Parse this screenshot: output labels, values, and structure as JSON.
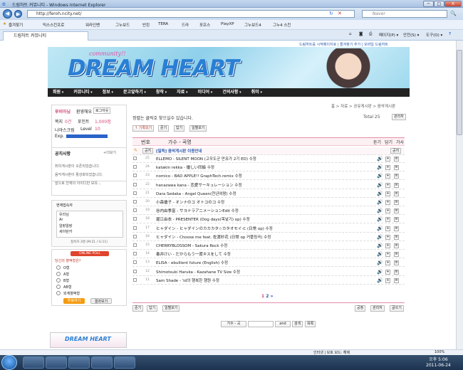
{
  "window": {
    "title": "드림하트 커뮤니티 - Windows Internet Explorer",
    "min": "─",
    "max": "□",
    "close": "X"
  },
  "address": {
    "url": "http://feroh.ncity.net/",
    "search_placeholder": "Naver"
  },
  "favbar": {
    "favorites": "즐겨찾기",
    "items": [
      "믹스스킨프로",
      "워라인벤",
      "그누보드",
      "빈킹",
      "TERA",
      "드라",
      "포프스",
      "PlayXP",
      "그누보드4",
      "그누4 스킨"
    ]
  },
  "tab": {
    "label": "드림하트 커뮤니티"
  },
  "cmdbar": {
    "page": "페이지(P) ▾",
    "safety": "안전(S) ▾",
    "tools": "도구(O) ▾",
    "help": "?"
  },
  "site": {
    "toplinks": "드림하트를 시작페이지로 | 즐겨찾기 추가 | 모바일 드림하트",
    "logo_small": "community!!",
    "logo": "DREAM HEART",
    "menu": [
      "회원",
      "커뮤니티",
      "정보",
      "문고앞하기",
      "창작",
      "자료",
      "미디어",
      "건의사항",
      "취미"
    ]
  },
  "user": {
    "greeting": "루비아님",
    "welcome": "환영해요",
    "logout": "로그아웃",
    "money_label": "쪽지",
    "money_value": "0건",
    "point_label": "포인트",
    "point_value": "1,000점",
    "nick": "나야스크림",
    "level_label": "Level",
    "level_value": "10",
    "exp_label": "Exp."
  },
  "notice": {
    "title": "공지사항",
    "more": "+더보기",
    "items": [
      "취미게시판이 오픈되었습니다.",
      "음악게시판이 활성화되었습니다.",
      "앞으로 잔재의 아이디만 보유..."
    ]
  },
  "chat": {
    "title": "현재접속자",
    "users": [
      "유리님",
      "Ar",
      "알랑알랑",
      "세이탄카"
    ],
    "count": "접속자 3명 (M:21 / G:11)"
  },
  "poll": {
    "header": "ONLINE POLL",
    "question": "당신의 혈액형은?",
    "options": [
      "O형",
      "A형",
      "B형",
      "AB형",
      "외계혈액형"
    ],
    "vote": "투표하기",
    "result": "결과보기"
  },
  "board": {
    "breadcrumb": "홈 > 자료 > 공유게시판 > 음악게시판",
    "desc": "정렬는 클릭호 찾으실수 있습니다.",
    "total_label": "Total 25",
    "admin": "관리자",
    "tools": [
      "↑ 기록보기",
      "준기",
      "답기",
      "일별보기"
    ],
    "col_num": "번호",
    "col_title": "가수 - 곡명",
    "col_listen": "듣기",
    "col_down": "담기",
    "col_lyric": "가사",
    "notice_tag": "공지",
    "notice_row": "[필독] 음악게시판 이용안내",
    "rows": [
      {
        "num": "25",
        "title": "ELLEMO - SILENT MOON (고우도군 만유가 2기 ED) 수정"
      },
      {
        "num": "24",
        "title": "katakin rekka - 優しい同級 수정"
      },
      {
        "num": "23",
        "title": "nomico - BAD APPLE!! GraphTech.remix 수정"
      },
      {
        "num": "22",
        "title": "hanazawa kana - 恋愛サーキュレーション 수정"
      },
      {
        "num": "21",
        "title": "Dara Sedaka - Angel Queen(천년여왕) 수정"
      },
      {
        "num": "20",
        "title": "小森優子 - オンナのコ オトコのコ 수정"
      },
      {
        "num": "19",
        "title": "谷内由季富 - サヨナラアニメーションEdit 수정"
      },
      {
        "num": "18",
        "title": "堀江由衣 - PRESENTER (Dog days(목넣기) op) 수정"
      },
      {
        "num": "17",
        "title": "ヒャダイン - ヒャダインのカカカタ☆カタオモイ-C (日常 op) 수정"
      },
      {
        "num": "16",
        "title": "ヒャダイン - Choose me feat. 佐渡紗花 (日常 op 커플링곡) 수정"
      },
      {
        "num": "15",
        "title": "CHERRYBLOSSOM - Sakura Rock 수정"
      },
      {
        "num": "14",
        "title": "奏井けい - だからもう一度キスをして 수정"
      },
      {
        "num": "13",
        "title": "ELISA - ebullient future (English) 수정"
      },
      {
        "num": "12",
        "title": "Shimotsuki Haruka - Kazahane TV Size 수정"
      },
      {
        "num": "11",
        "title": "Sam Shade - 'id의 행복한 행원 수정"
      }
    ],
    "pages": [
      "1",
      "2",
      "»"
    ],
    "bottom_left": [
      "준기",
      "답기",
      "일별보기"
    ],
    "bottom_right": [
      "공정",
      "관리자",
      "글쓰기"
    ],
    "search_field": "가수 - 곡",
    "search_and": "and",
    "search_btn": "검색",
    "search_btn2": "목록"
  },
  "status": {
    "zone": "인터넷 | 보호 모드: 해제",
    "zoom": "100%"
  },
  "clock": {
    "time": "오후 5:06",
    "date": "2011-06-24"
  }
}
